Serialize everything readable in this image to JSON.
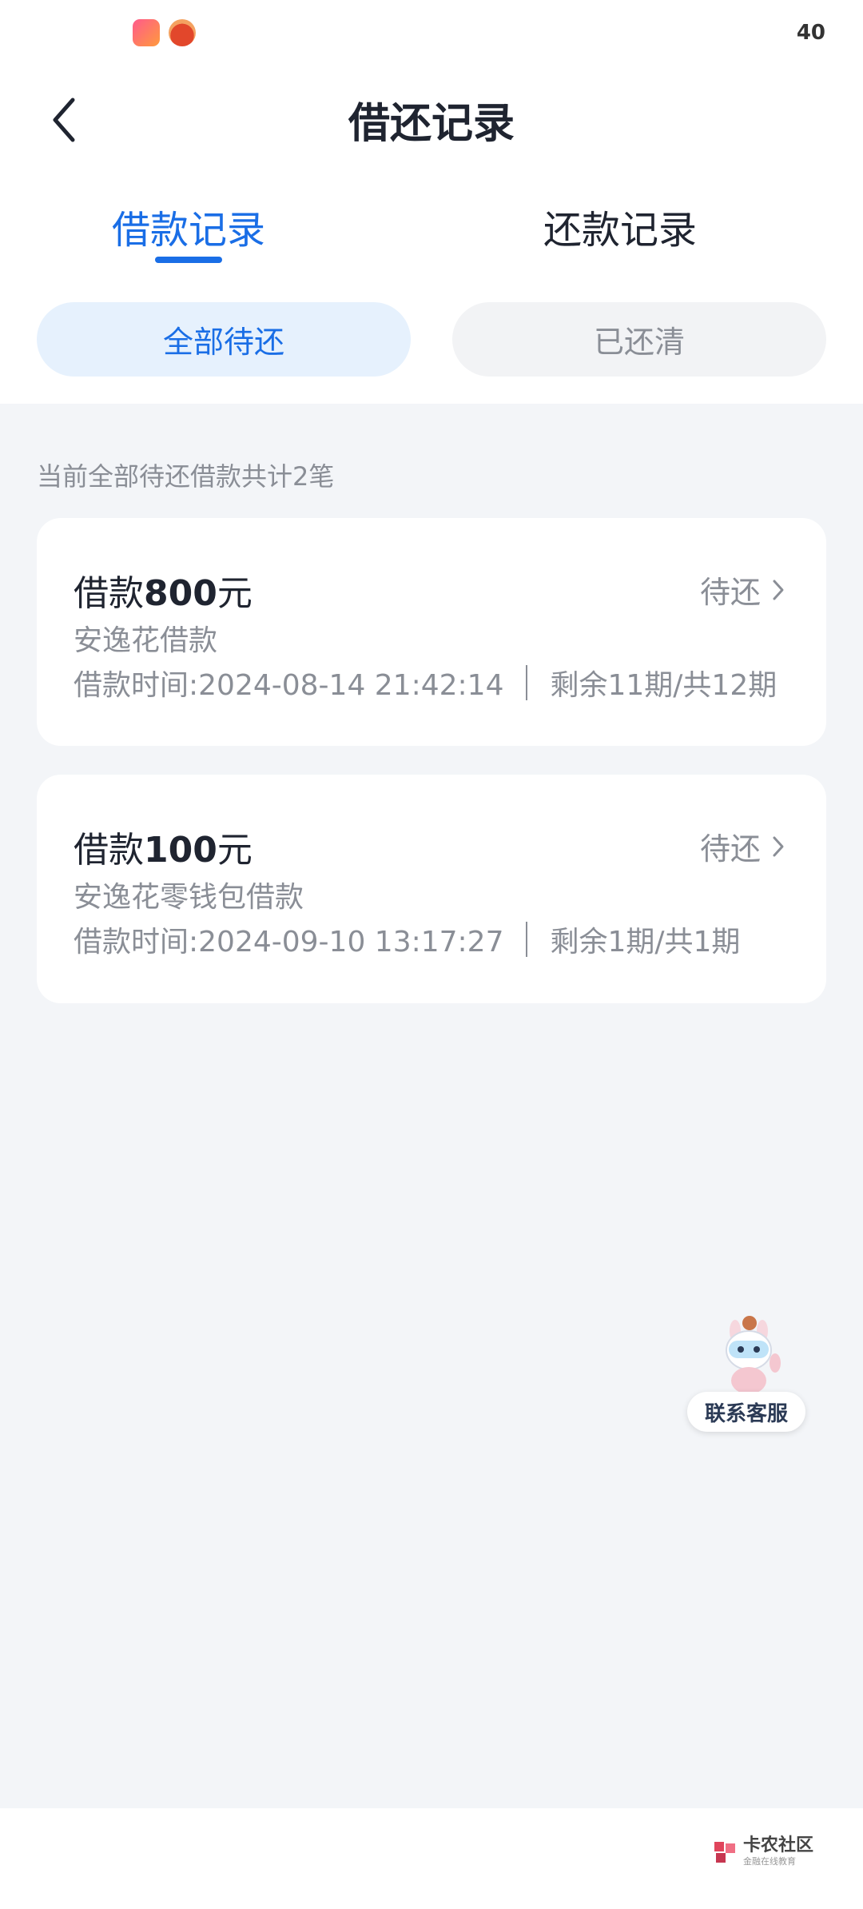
{
  "status_bar": {
    "time": "40",
    "notification_icons": [
      "app-notification-icon",
      "app-notification-icon"
    ]
  },
  "header": {
    "title": "借还记录",
    "back_icon": "chevron-left-icon"
  },
  "tabs": [
    {
      "label": "借款记录",
      "active": true
    },
    {
      "label": "还款记录",
      "active": false
    }
  ],
  "filters": [
    {
      "label": "全部待还",
      "active": true
    },
    {
      "label": "已还清",
      "active": false
    }
  ],
  "summary": "当前全部待还借款共计2笔",
  "loans": [
    {
      "title_prefix": "借款",
      "amount": "800",
      "unit": "元",
      "status": "待还",
      "product": "安逸花借款",
      "time": "借款时间:2024-08-14 21:42:14",
      "periods": "剩余11期/共12期"
    },
    {
      "title_prefix": "借款",
      "amount": "100",
      "unit": "元",
      "status": "待还",
      "product": "安逸花零钱包借款",
      "time": "借款时间:2024-09-10 13:17:27",
      "periods": "剩余1期/共1期"
    }
  ],
  "customer_service": {
    "label": "联系客服",
    "icon": "mascot-icon"
  },
  "watermark": {
    "text": "卡农社区",
    "subtext": "金融在线教育"
  },
  "colors": {
    "accent": "#1a6ee6",
    "background": "#f3f5f8",
    "muted_text": "#8a8e96"
  }
}
